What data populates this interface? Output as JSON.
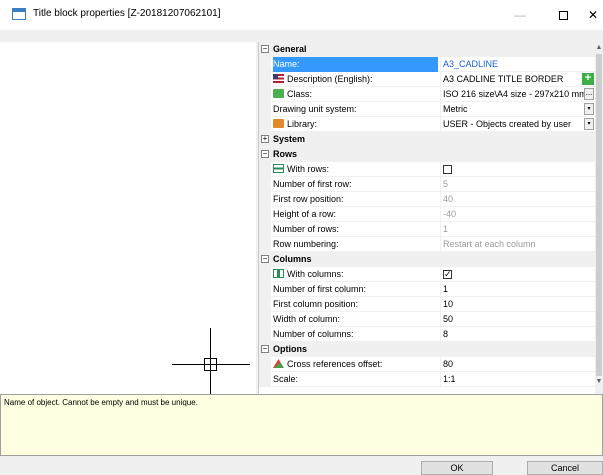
{
  "window": {
    "title": "Title block properties [Z-20181207062101]",
    "min_symbol": "—",
    "close_symbol": "✕"
  },
  "grid": {
    "categories": {
      "general": "General",
      "system": "System",
      "rows": "Rows",
      "columns": "Columns",
      "options": "Options"
    },
    "general": {
      "name_label": "Name:",
      "name_value": "A3_CADLINE",
      "description_label": "Description (English):",
      "description_value": "A3 CADLINE TITLE BORDER",
      "class_label": "Class:",
      "class_value": "ISO 216 size\\A4 size - 297x210 mm",
      "units_label": "Drawing unit system:",
      "units_value": "Metric",
      "library_label": "Library:",
      "library_value": "USER - Objects created by user"
    },
    "rows": {
      "with_rows_label": "With rows:",
      "first_row_number_label": "Number of first row:",
      "first_row_number_value": "5",
      "first_row_position_label": "First row position:",
      "first_row_position_value": "40",
      "row_height_label": "Height of a row:",
      "row_height_value": "-40",
      "row_count_label": "Number of rows:",
      "row_count_value": "1",
      "row_numbering_label": "Row numbering:",
      "row_numbering_value": "Restart at each column"
    },
    "columns": {
      "with_columns_label": "With columns:",
      "with_columns_check": "✓",
      "first_column_number_label": "Number of first column:",
      "first_column_number_value": "1",
      "first_column_position_label": "First column position:",
      "first_column_position_value": "10",
      "column_width_label": "Width of column:",
      "column_width_value": "50",
      "column_count_label": "Number of columns:",
      "column_count_value": "8"
    },
    "options": {
      "xref_offset_label": "Cross references offset:",
      "xref_offset_value": "80",
      "scale_label": "Scale:",
      "scale_value": "1:1"
    },
    "buttons": {
      "add": "+",
      "ellipsis": "...",
      "dropdown": "▾"
    }
  },
  "description_panel": {
    "text": "Name of object. Cannot be empty and must be unique."
  },
  "footer": {
    "ok_label": "OK",
    "cancel_label": "Cancel"
  },
  "colors": {
    "selection": "#3399ff",
    "description_background": "#ffffe1",
    "add_button": "#3cb043"
  }
}
